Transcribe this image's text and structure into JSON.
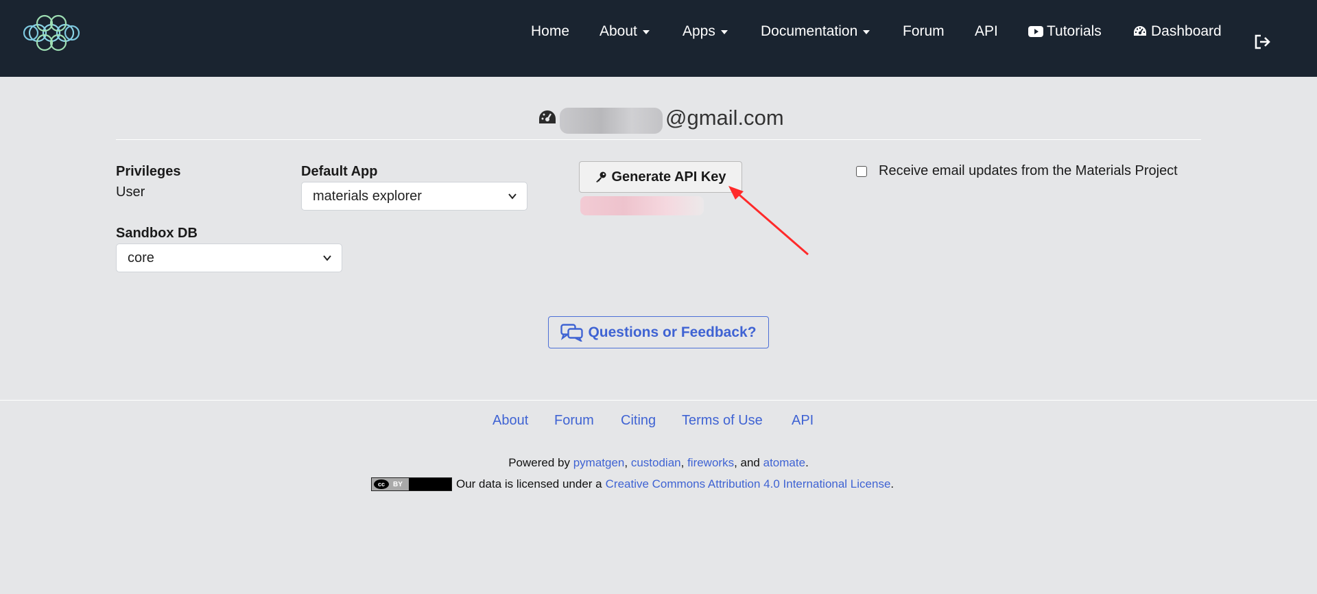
{
  "nav": {
    "items": [
      {
        "label": "Home",
        "dropdown": false
      },
      {
        "label": "About",
        "dropdown": true
      },
      {
        "label": "Apps",
        "dropdown": true
      },
      {
        "label": "Documentation",
        "dropdown": true
      },
      {
        "label": "Forum",
        "dropdown": false
      },
      {
        "label": "API",
        "dropdown": false
      },
      {
        "label": "Tutorials",
        "icon": "youtube-icon",
        "dropdown": false
      },
      {
        "label": "Dashboard",
        "icon": "dashboard-icon",
        "dropdown": false
      }
    ],
    "signout_icon": "sign-out-icon"
  },
  "profile": {
    "email_suffix": "@gmail.com",
    "privileges_label": "Privileges",
    "privileges_value": "User",
    "default_app_label": "Default App",
    "default_app_value": "materials explorer",
    "sandbox_label": "Sandbox DB",
    "sandbox_value": "core",
    "generate_key_label": "Generate API Key",
    "email_updates_label": "Receive email updates from the Materials Project",
    "email_updates_checked": false
  },
  "feedback_label": "Questions or Feedback?",
  "footer": {
    "links": [
      "About",
      "Forum",
      "Citing",
      "Terms of Use",
      "API"
    ],
    "powered_prefix": "Powered by ",
    "powered_links": [
      "pymatgen",
      "custodian",
      "fireworks",
      "atomate"
    ],
    "sep": ", ",
    "and_text": ", and ",
    "period": ".",
    "license_text": "Our data is licensed under a ",
    "license_link": "Creative Commons Attribution 4.0 International License",
    "license_badge": [
      "cc",
      "BY"
    ]
  },
  "colors": {
    "navbar": "#1a2430",
    "background": "#e5e6e8",
    "link": "#3f63d3",
    "annotation_arrow": "#ff2a2a"
  }
}
